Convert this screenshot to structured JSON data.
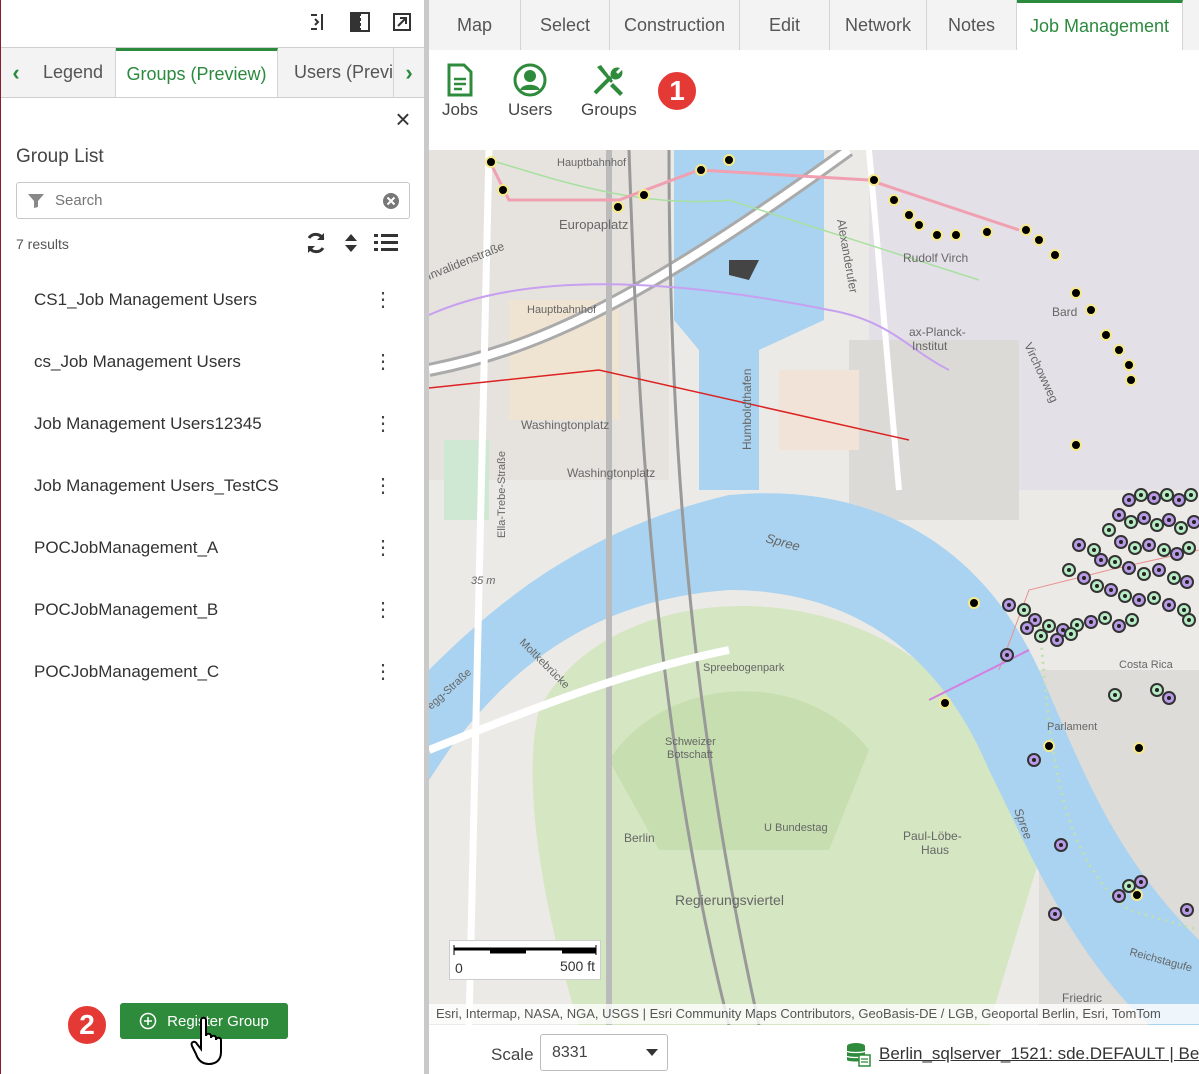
{
  "panel": {
    "tabs": [
      "Legend",
      "Groups (Preview)",
      "Users (Previe"
    ],
    "active_tab": "Groups (Preview)",
    "title": "Group List",
    "search_placeholder": "Search",
    "result_count": "7 results",
    "groups": [
      "CS1_Job Management Users",
      "cs_Job Management Users",
      "Job Management Users12345",
      "Job Management Users_TestCS",
      "POCJobManagement_A",
      "POCJobManagement_B",
      "POCJobManagement_C"
    ],
    "register_button": "Register Group"
  },
  "ribbon": {
    "tabs": [
      "Map",
      "Select",
      "Construction",
      "Edit",
      "Network",
      "Notes",
      "Job Management"
    ],
    "active_tab": "Job Management",
    "buttons": [
      {
        "label": "Jobs",
        "icon": "document-icon"
      },
      {
        "label": "Users",
        "icon": "user-icon"
      },
      {
        "label": "Groups",
        "icon": "tools-icon"
      }
    ]
  },
  "callouts": [
    "1",
    "2"
  ],
  "map": {
    "labels": {
      "hauptbahnhof_top": "Hauptbahnhof",
      "europaplatz": "Europaplatz",
      "invalidenstrasse": "Invalidenstraße",
      "alexanderufer": "Alexanderufer",
      "rudolf_virchow": "Rudolf Virch",
      "planck_institut": "ax-Planck-",
      "planck_institut2": "Institut",
      "hauptbahnhof": "Hauptbahnhof",
      "humboldthafen": "Humboldthafen",
      "washingtonplatz": "Washingtonplatz",
      "washingtonplatz2": "Washingtonplatz",
      "ella_trebe": "Ella-Trebe-Straße",
      "virchowweg": "Virchowweg",
      "spree": "Spree",
      "spree2": "Spree",
      "elevation": "35 m",
      "spreebogenpark": "Spreebogenpark",
      "moltkebruecke": "Moltkebrücke",
      "berlin": "Berlin",
      "u_bundestag": "U Bundestag",
      "paul_loebe": "Paul-Löbe-",
      "paul_loebe2": "Haus",
      "regierungsviertel": "Regierungsviertel",
      "schweizer": "Schweizer",
      "botschaft": "Botschaft",
      "parlament": "Parlament",
      "reichstagufer": "Reichstagufe",
      "friedrich": "Friedric",
      "bard": "Bard",
      "costa_rica": "Costa Rica",
      "egg_strasse": "egg-Straße"
    },
    "scalebar": {
      "left": "0",
      "right": "500 ft"
    },
    "attribution": "Esri, Intermap, NASA, NGA, USGS | Esri Community Maps Contributors, GeoBasis-DE / LGB, Geoportal Berlin, Esri, TomTom"
  },
  "footer": {
    "scale_label": "Scale",
    "scale_value": "8331",
    "workspace": "Berlin_sqlserver_1521: sde.DEFAULT | Berli"
  }
}
